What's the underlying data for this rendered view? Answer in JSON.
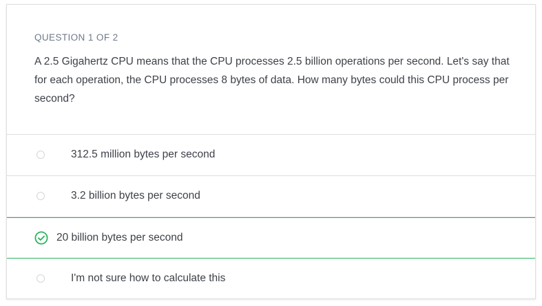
{
  "question": {
    "counter": "QUESTION 1 OF 2",
    "prompt": "A 2.5 Gigahertz CPU means that the CPU processes 2.5 billion operations per second. Let's say that for each operation, the CPU processes 8 bytes of data. How many bytes could this CPU process per second?"
  },
  "options": [
    {
      "label": "312.5 million bytes per second",
      "state": "unselected"
    },
    {
      "label": "3.2 billion bytes per second",
      "state": "unselected"
    },
    {
      "label": "20 billion bytes per second",
      "state": "correct-selected"
    },
    {
      "label": "I'm not sure how to calculate this",
      "state": "unselected"
    }
  ],
  "colors": {
    "correct": "#2bb35e",
    "border": "#dedede",
    "text": "#3d4148",
    "muted": "#6f7a89"
  },
  "icons": {
    "selected": "check-circle-icon",
    "unselected": "radio-empty-icon"
  }
}
